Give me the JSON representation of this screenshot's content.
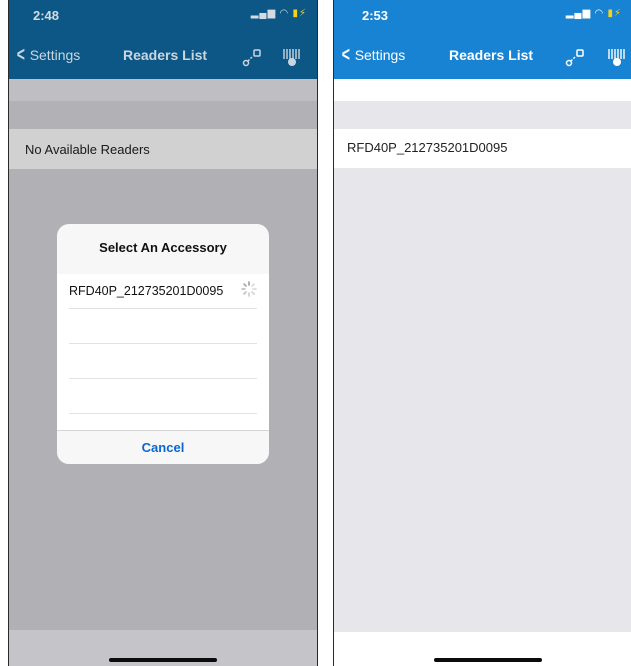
{
  "left_screen": {
    "status": {
      "time": "2:48"
    },
    "nav": {
      "back_label": "Settings",
      "title": "Readers List"
    },
    "empty_message": "No Available Readers",
    "dialog": {
      "title": "Select An Accessory",
      "items": [
        "RFD40P_212735201D0095",
        "",
        "",
        ""
      ],
      "cancel_label": "Cancel"
    }
  },
  "right_screen": {
    "status": {
      "time": "2:53"
    },
    "nav": {
      "back_label": "Settings",
      "title": "Readers List"
    },
    "readers": [
      "RFD40P_212735201D0095"
    ]
  },
  "colors": {
    "nav_left_dimmed": "#0d5786",
    "nav_right": "#1883d3",
    "battery_charging": "#f5d21b",
    "action_blue": "#0a66d6"
  },
  "icons": [
    "chevron-left-icon",
    "wifi-icon",
    "battery-charging-icon",
    "rfid-connection-icon",
    "barcode-scanner-icon",
    "spinner-icon"
  ]
}
